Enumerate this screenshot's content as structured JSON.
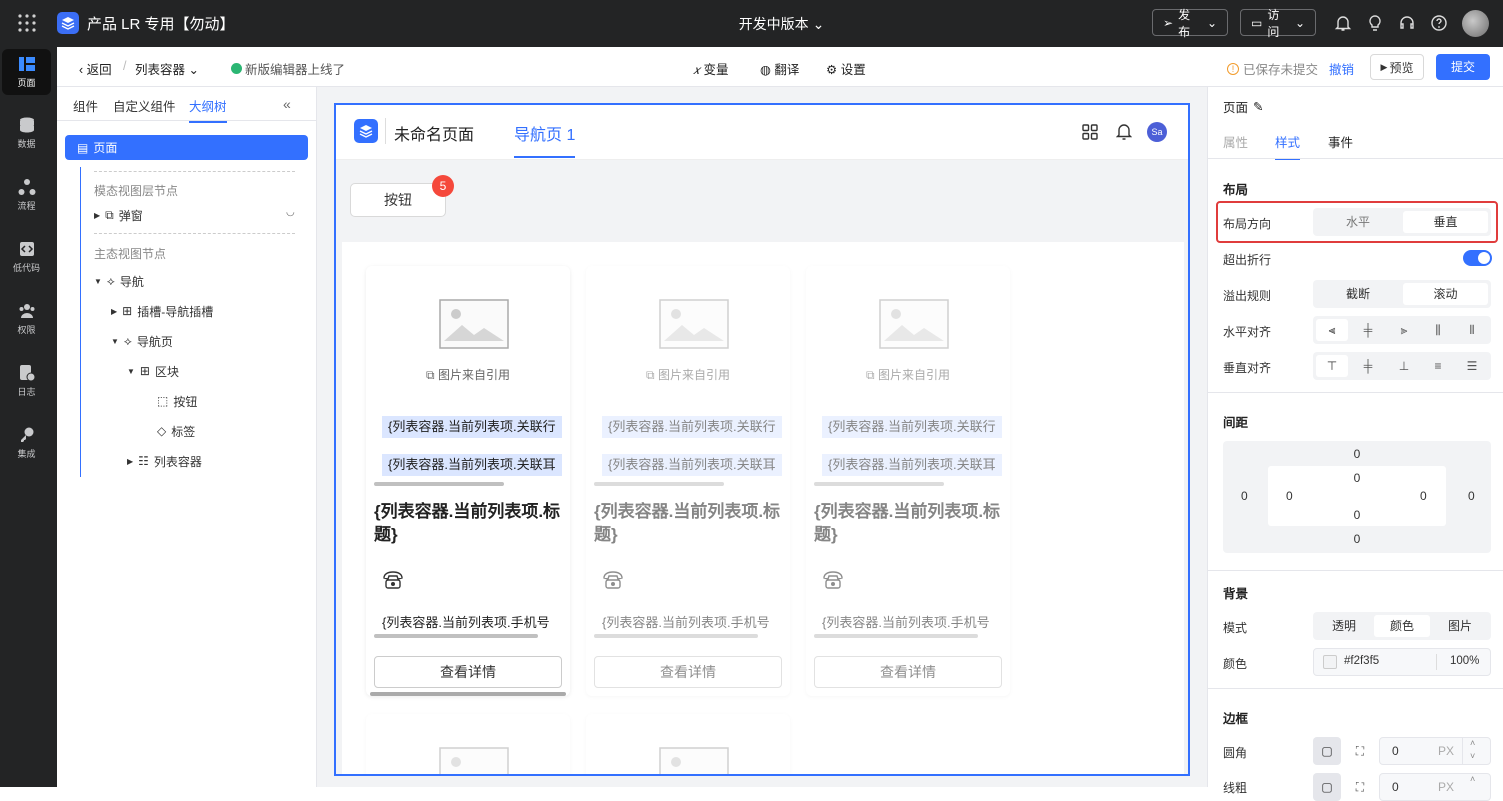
{
  "topbar": {
    "title": "产品 LR 专用【勿动】",
    "version": "开发中版本",
    "publish": "发布",
    "visit": "访问"
  },
  "leftnav": [
    {
      "label": "页面"
    },
    {
      "label": "数据"
    },
    {
      "label": "流程"
    },
    {
      "label": "低代码"
    },
    {
      "label": "权限"
    },
    {
      "label": "日志"
    },
    {
      "label": "集成"
    }
  ],
  "subbar": {
    "back": "返回",
    "crumb": "列表容器",
    "notice": "新版编辑器上线了",
    "variable": "变量",
    "translate": "翻译",
    "settings": "设置",
    "saved": "已保存未提交",
    "undo": "撤销",
    "preview": "预览",
    "submit": "提交"
  },
  "outline": {
    "tabs": [
      "组件",
      "自定义组件",
      "大纲树"
    ],
    "root": "页面",
    "modal_head": "模态视图层节点",
    "popup": "弹窗",
    "main_head": "主态视图节点",
    "nav": "导航",
    "slot": "插槽-导航插槽",
    "navpage": "导航页",
    "block": "区块",
    "button": "按钮",
    "tag": "标签",
    "list": "列表容器"
  },
  "canvas": {
    "page_title": "未命名页面",
    "nav_tab": "导航页 1",
    "avatar": "Sa",
    "button": "按钮",
    "badge": "5",
    "card": {
      "img_caption": "图片来自引用",
      "tag1": "{列表容器.当前列表项.关联行",
      "tag2": "{列表容器.当前列表项.关联耳",
      "title": "{列表容器.当前列表项.标题}",
      "phone": "{列表容器.当前列表项.手机号",
      "detail": "查看详情"
    }
  },
  "right": {
    "page_label": "页面",
    "tabs": [
      "属性",
      "样式",
      "事件"
    ],
    "layout": "布局",
    "direction": "布局方向",
    "horizontal": "水平",
    "vertical": "垂直",
    "wrap": "超出折行",
    "overflow": "溢出规则",
    "cut": "截断",
    "scroll": "滚动",
    "halign": "水平对齐",
    "valign": "垂直对齐",
    "spacing": "间距",
    "margin_val": "0",
    "bg": "背景",
    "mode": "模式",
    "transparent": "透明",
    "color_opt": "颜色",
    "image": "图片",
    "color_label": "颜色",
    "color_hex": "#f2f3f5",
    "opacity": "100%",
    "border": "边框",
    "radius": "圆角",
    "radius_val": "0",
    "px": "PX",
    "stroke": "线粗",
    "stroke_val": "0"
  }
}
